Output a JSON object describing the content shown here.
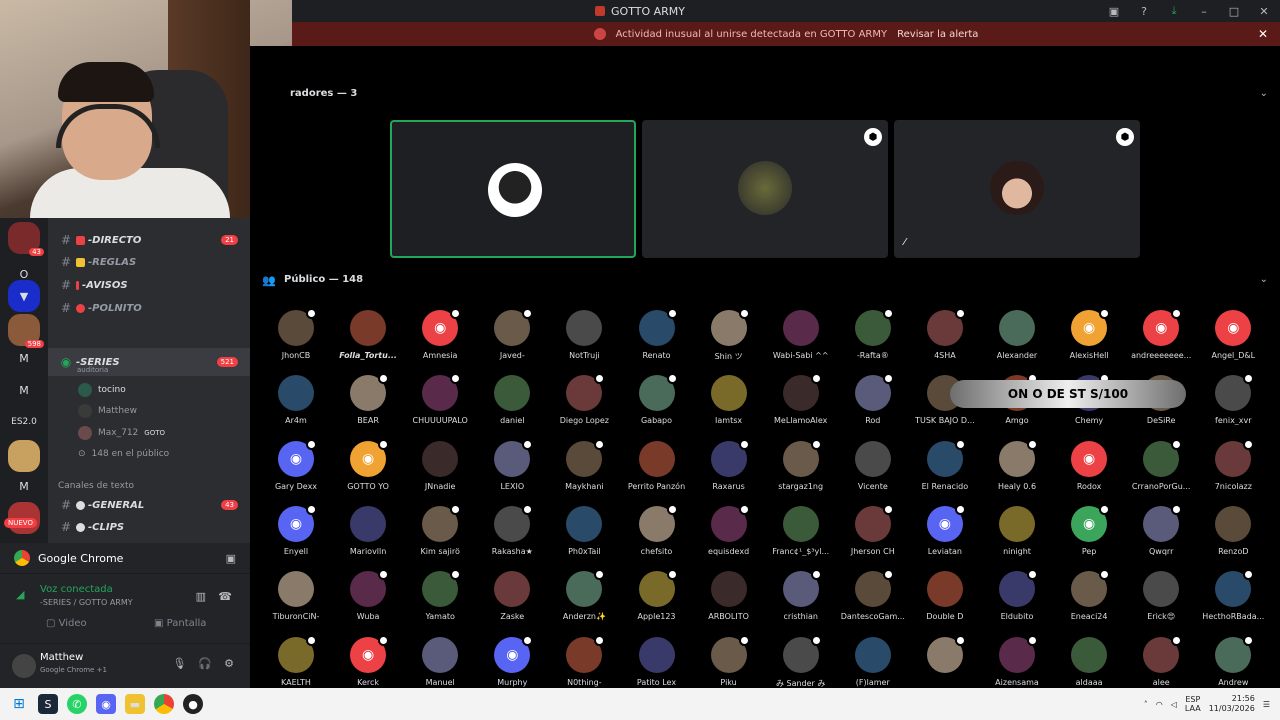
{
  "window": {
    "title": "GOTTO ARMY"
  },
  "alert": {
    "message": "Actividad inusual al unirse detectada en GOTTO ARMY",
    "action": "Revisar la alerta"
  },
  "rail": {
    "badges": [
      "43",
      "598"
    ],
    "letters": [
      "O",
      "M",
      "M",
      "ES2.0",
      "M"
    ],
    "nuevo": "NUEVO"
  },
  "channels": {
    "directo": "-DIRECTO",
    "directo_count": "21",
    "reglas": "-REGLAS",
    "avisos": "-AVISOS",
    "polnito": "-POLNITO",
    "series": "-SERIES",
    "series_count": "521",
    "series_sub": "auditoria",
    "voice_users": [
      "tocino",
      "Matthew",
      "Max_712"
    ],
    "max_tag": "GOTO",
    "public_count": "148 en el público",
    "category": "Canales de texto",
    "general": "-GENERAL",
    "general_count": "43",
    "clips": "-CLIPS"
  },
  "chrome_bar": {
    "label": "Google Chrome"
  },
  "voice": {
    "status": "Voz conectada",
    "location": "-SERIES / GOTTO ARMY",
    "video": "Video",
    "screen": "Pantalla"
  },
  "user": {
    "name": "Matthew",
    "status": "Google Chrome +1"
  },
  "stage": {
    "speakers_title": "radores — 3",
    "audience_title": "Público — 148",
    "overlay": "ON O DE  ST  S/100"
  },
  "members": [
    [
      "JhonCB",
      "Folla_Tortu...",
      "Amnesia",
      "Javed-",
      "NotTruji",
      "Renato",
      "Shin ツ",
      "Wabi-Sabi ^^",
      "-Rafta®",
      "4SHA",
      "Alexander",
      "AlexisHell",
      "andreeeeeee...",
      "Angel_D&L"
    ],
    [
      "Ar4m",
      "BEAR",
      "CHUUUUPALO",
      "daniel",
      "Diego Lopez",
      "Gabapo",
      "Iamtsx",
      "MeLlamoAlex",
      "Rod",
      "TUSK BAJO D...",
      "Amgo",
      "Chemy",
      "DeSiRe",
      "fenix_xvr"
    ],
    [
      "Gary Dexx",
      "GOTTO YO",
      "JNnadie",
      "LEXIO",
      "Maykhani",
      "Perrito Panzón",
      "Raxarus",
      "stargaz1ng",
      "Vicente",
      "El Renacido",
      "Healy 0.6",
      "Rodox",
      "CrranoPorGu...",
      "7nicolazz"
    ],
    [
      "Enyell",
      "Mariovlln",
      "Kim sajirö",
      "Rakasha★",
      "Ph0xTail",
      "chefsito",
      "equisdexd",
      "Franc¢¹_$³yl...",
      "Jherson CH",
      "Leviatan",
      "ninight",
      "Pep",
      "Qwqrr",
      "RenzoD"
    ],
    [
      "TiburonCiN-",
      "Wuba",
      "Yamato",
      "Zaske",
      "Anderzn✨",
      "Apple123",
      "ARBOLITO",
      "cristhian",
      "DantescoGam...",
      "Double D",
      "Eldubito",
      "Eneaci24",
      "Erick😍",
      "HecthoRBada..."
    ],
    [
      "KAELTH",
      "Kerck",
      "Manuel",
      "Murphy",
      "N0thing-",
      "Patito Lex",
      "Piku",
      "み Sander み",
      "(F)lamer",
      "",
      "Aizensama",
      "aldaaa",
      "alee",
      "Andrew"
    ]
  ],
  "taskbar": {
    "lang1": "ESP",
    "lang2": "LAA",
    "time": "21:56",
    "date": "11/03/2026"
  }
}
